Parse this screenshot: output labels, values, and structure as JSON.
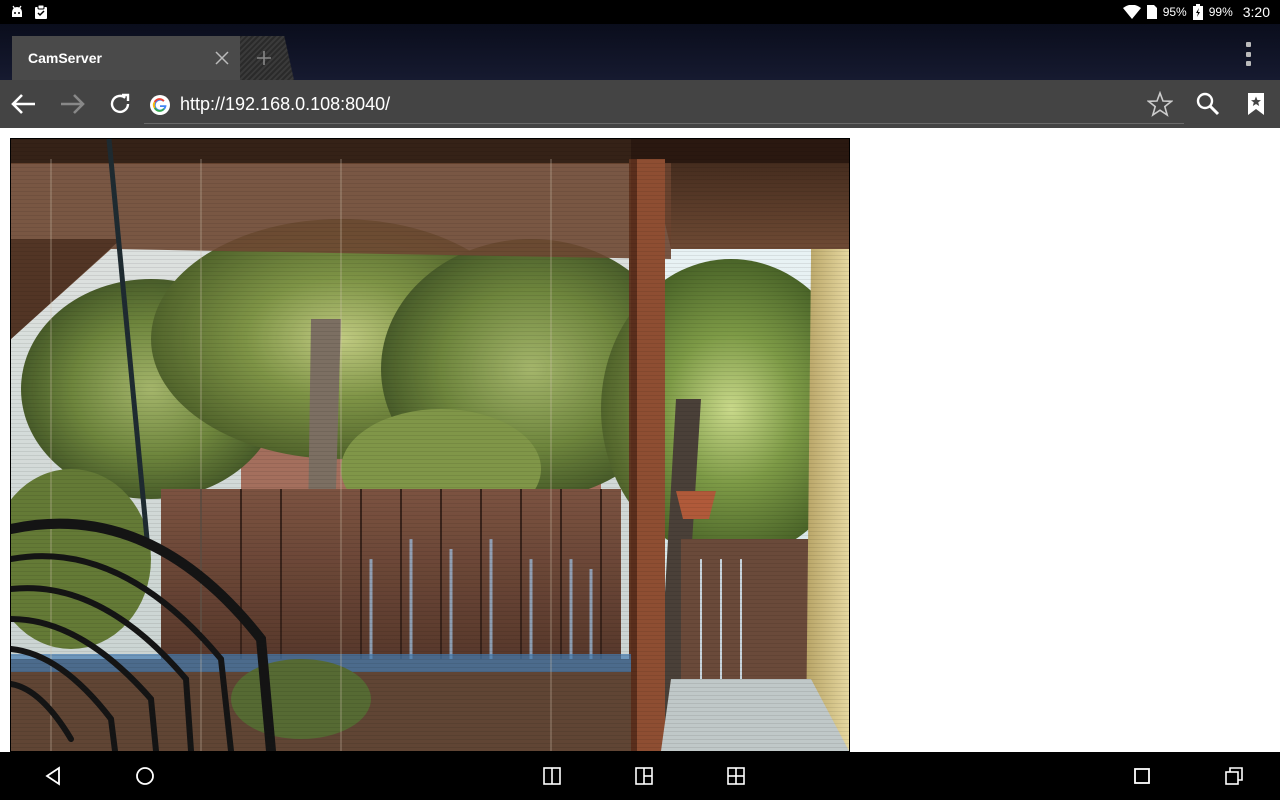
{
  "status_bar": {
    "left_icons": [
      "android-debug-icon",
      "clipboard-check-icon"
    ],
    "wifi_icon": "wifi-icon",
    "sim_percent": "95%",
    "battery_percent": "99%",
    "time": "3:20"
  },
  "browser": {
    "tab": {
      "title": "CamServer"
    },
    "address_bar": {
      "url": "http://192.168.0.108:8040/"
    }
  },
  "page": {
    "camera_image": {
      "scene": "porch with wooden fence, trees and rattan chair"
    }
  },
  "nav_bar": {
    "buttons": [
      "back-icon",
      "home-icon",
      "split-2-icon",
      "split-3-icon",
      "split-4-icon",
      "recents-icon",
      "multiwindow-icon"
    ]
  }
}
